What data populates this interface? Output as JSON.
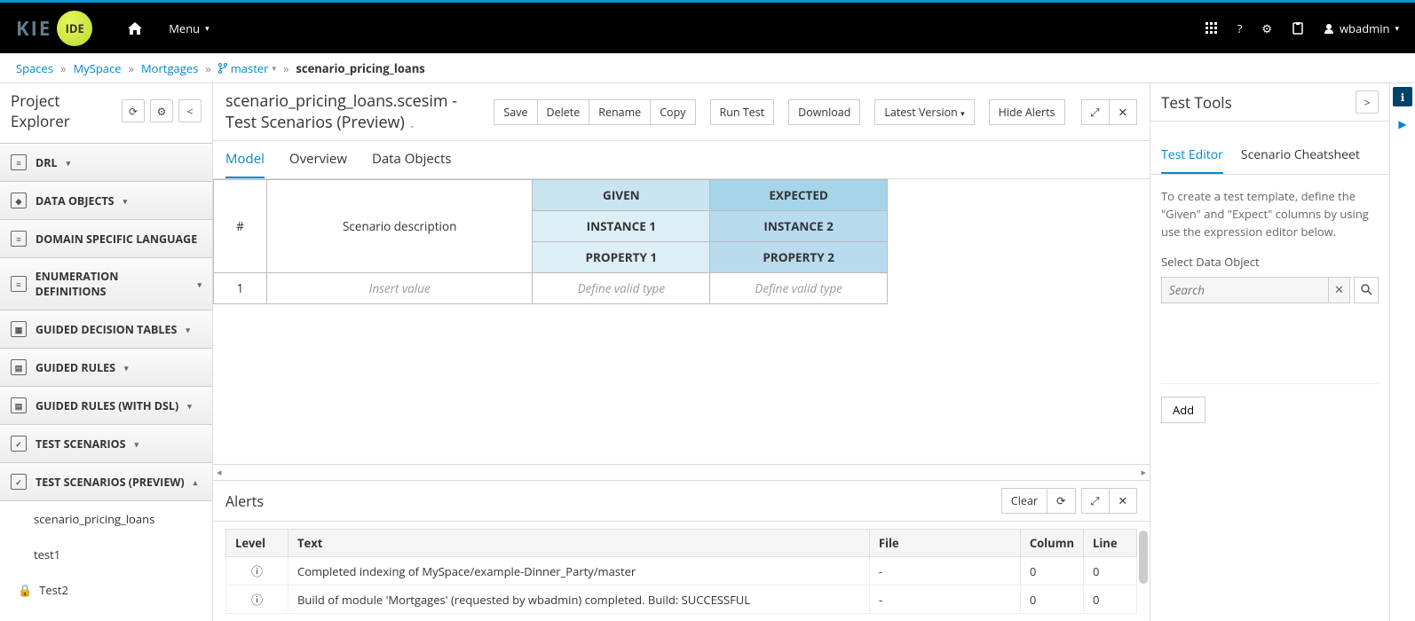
{
  "topbar": {
    "kie": "KIE",
    "ide": "IDE",
    "menu": "Menu",
    "user": "wbadmin"
  },
  "breadcrumbs": {
    "spaces": "Spaces",
    "space": "MySpace",
    "project": "Mortgages",
    "branch": "master",
    "current": "scenario_pricing_loans"
  },
  "explorer": {
    "title": "Project Explorer",
    "cats": {
      "drl": "DRL",
      "dataobj": "DATA OBJECTS",
      "dsl": "DOMAIN SPECIFIC LANGUAGE",
      "enum": "ENUMERATION DEFINITIONS",
      "gdt": "GUIDED DECISION TABLES",
      "gr": "GUIDED RULES",
      "grdsl": "GUIDED RULES (WITH DSL)",
      "ts": "TEST SCENARIOS",
      "tsp": "TEST SCENARIOS (PREVIEW)"
    },
    "leaves": {
      "l1": "scenario_pricing_loans",
      "l2": "test1",
      "l3": "Test2"
    }
  },
  "editor": {
    "title": "scenario_pricing_loans.scesim - Test Scenarios (Preview)",
    "buttons": {
      "save": "Save",
      "delete": "Delete",
      "rename": "Rename",
      "copy": "Copy",
      "runtest": "Run Test",
      "download": "Download",
      "latest": "Latest Version",
      "hidealerts": "Hide Alerts"
    },
    "tabs": {
      "model": "Model",
      "overview": "Overview",
      "dataobj": "Data Objects"
    },
    "grid": {
      "hash": "#",
      "desc": "Scenario description",
      "given": "GIVEN",
      "expected": "EXPECTED",
      "inst1": "INSTANCE 1",
      "inst2": "INSTANCE 2",
      "prop1": "PROPERTY 1",
      "prop2": "PROPERTY 2",
      "row1": "1",
      "insertval": "Insert value",
      "defvalid": "Define valid type"
    }
  },
  "alerts": {
    "title": "Alerts",
    "clear": "Clear",
    "cols": {
      "level": "Level",
      "text": "Text",
      "file": "File",
      "column": "Column",
      "line": "Line"
    },
    "rows": [
      {
        "text": "Completed indexing of MySpace/example-Dinner_Party/master",
        "file": "-",
        "col": "0",
        "line": "0"
      },
      {
        "text": "Build of module 'Mortgages' (requested by wbadmin) completed. Build: SUCCESSFUL",
        "file": "-",
        "col": "0",
        "line": "0"
      }
    ]
  },
  "tools": {
    "title": "Test Tools",
    "tabs": {
      "editor": "Test Editor",
      "cheat": "Scenario Cheatsheet"
    },
    "help": "To create a test template, define the \"Given\" and \"Expect\" columns by using use the expression editor below.",
    "selectlabel": "Select Data Object",
    "searchph": "Search",
    "add": "Add"
  }
}
